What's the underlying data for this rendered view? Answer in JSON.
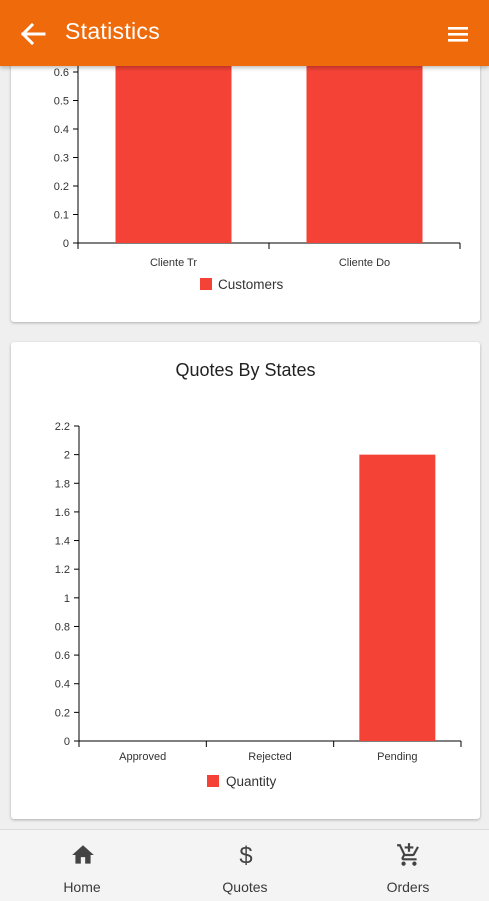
{
  "appbar": {
    "title": "Statistics",
    "back_icon": "arrow-left-icon",
    "menu_icon": "hamburger-menu-icon",
    "background": "#ee6a0b"
  },
  "charts": {
    "customers": {
      "legend": "Customers"
    },
    "quotes": {
      "title": "Quotes By States",
      "legend": "Quantity"
    }
  },
  "chart_data": [
    {
      "type": "bar",
      "categories": [
        "Cliente Tr",
        "Cliente Do"
      ],
      "series": [
        {
          "name": "Customers",
          "values": [
            1,
            1
          ]
        }
      ],
      "y_ticks_visible": [
        "0",
        "0.1",
        "0.2",
        "0.3",
        "0.4",
        "0.5",
        "0.6"
      ],
      "color": "#f44336",
      "legend_position": "bottom",
      "grid": false
    },
    {
      "type": "bar",
      "title": "Quotes By States",
      "categories": [
        "Approved",
        "Rejected",
        "Pending"
      ],
      "series": [
        {
          "name": "Quantity",
          "values": [
            0,
            0,
            2
          ]
        }
      ],
      "ylim": [
        0,
        2.2
      ],
      "y_ticks": [
        "0",
        "0.2",
        "0.4",
        "0.6",
        "0.8",
        "1",
        "1.2",
        "1.4",
        "1.6",
        "1.8",
        "2",
        "2.2"
      ],
      "color": "#f44336",
      "legend_position": "bottom",
      "grid": false
    }
  ],
  "bottom_nav": {
    "items": [
      {
        "label": "Home",
        "icon": "home-icon"
      },
      {
        "label": "Quotes",
        "icon": "dollar-icon"
      },
      {
        "label": "Orders",
        "icon": "cart-add-icon"
      }
    ]
  }
}
